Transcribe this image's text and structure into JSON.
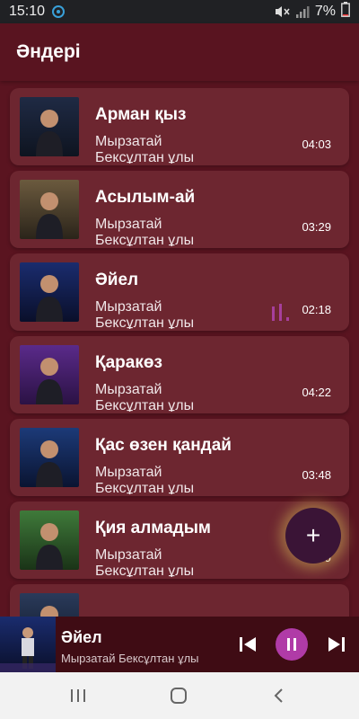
{
  "status_bar": {
    "time": "15:10",
    "battery": "7%"
  },
  "app_bar": {
    "title": "Әндері"
  },
  "songs": [
    {
      "title": "Арман қыз",
      "artist": "Мырзатай Бексұлтан ұлы",
      "duration": "04:03",
      "playing": false,
      "thumb_colors": [
        "#1f2a44",
        "#0e1420"
      ]
    },
    {
      "title": "Асылым-ай",
      "artist": "Мырзатай Бексұлтан ұлы",
      "duration": "03:29",
      "playing": false,
      "thumb_colors": [
        "#6b5a3e",
        "#2b241a"
      ]
    },
    {
      "title": "Әйел",
      "artist": "Мырзатай Бексұлтан ұлы",
      "duration": "02:18",
      "playing": true,
      "thumb_colors": [
        "#1a2c6e",
        "#0a0f2a"
      ]
    },
    {
      "title": "Қаракөз",
      "artist": "Мырзатай Бексұлтан ұлы",
      "duration": "04:22",
      "playing": false,
      "thumb_colors": [
        "#5a2a8a",
        "#2b1244"
      ]
    },
    {
      "title": "Қас өзен қандай",
      "artist": "Мырзатай Бексұлтан ұлы",
      "duration": "03:48",
      "playing": false,
      "thumb_colors": [
        "#1c3a78",
        "#0a1431"
      ]
    },
    {
      "title": "Қия алмадым",
      "artist": "Мырзатай Бексұлтан ұлы",
      "duration": "03:39",
      "playing": false,
      "thumb_colors": [
        "#3f7a3a",
        "#1a3317"
      ]
    },
    {
      "title": "",
      "artist": "",
      "duration": "",
      "playing": false,
      "thumb_colors": [
        "#2a3a5a",
        "#111a2a"
      ]
    }
  ],
  "fab": {
    "label": "+"
  },
  "mini_player": {
    "title": "Әйел",
    "artist": "Мырзатай Бексұлтан ұлы"
  },
  "colors": {
    "background": "#5a1420",
    "card": "#6d2630",
    "accent": "#b03ba7",
    "eq": "#a63f9c"
  }
}
